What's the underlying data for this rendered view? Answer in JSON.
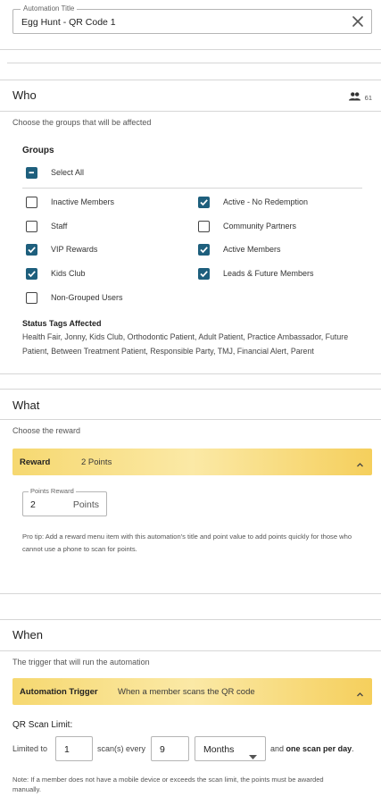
{
  "title_field": {
    "legend": "Automation Title",
    "value": "Egg Hunt - QR Code 1"
  },
  "who": {
    "title": "Who",
    "member_count": "61",
    "subtitle": "Choose the groups that will be affected",
    "groups_label": "Groups",
    "select_all": "Select All",
    "groups": [
      {
        "label": "Inactive Members",
        "checked": false
      },
      {
        "label": "Active - No Redemption",
        "checked": true
      },
      {
        "label": "Staff",
        "checked": false
      },
      {
        "label": "Community Partners",
        "checked": false
      },
      {
        "label": "VIP Rewards",
        "checked": true
      },
      {
        "label": "Active Members",
        "checked": true
      },
      {
        "label": "Kids Club",
        "checked": true
      },
      {
        "label": "Leads & Future Members",
        "checked": true
      },
      {
        "label": "Non-Grouped Users",
        "checked": false
      }
    ],
    "status_tags_label": "Status Tags Affected",
    "status_tags": "Health Fair, Jonny, Kids Club, Orthodontic Patient, Adult Patient, Practice Ambassador, Future Patient, Between Treatment Patient, Responsible Party, TMJ, Financial Alert, Parent"
  },
  "what": {
    "title": "What",
    "subtitle": "Choose the reward",
    "reward_label": "Reward",
    "reward_value": "2 Points",
    "points_legend": "Points Reward",
    "points_value": "2",
    "points_unit": "Points",
    "protip": "Pro tip: Add a reward menu item with this automation's title and point value to add points quickly for those who cannot use a phone to scan for points."
  },
  "when": {
    "title": "When",
    "subtitle": "The trigger that will run the automation",
    "trigger_label": "Automation Trigger",
    "trigger_value": "When a member scans the QR code",
    "qr_limit_label": "QR Scan Limit:",
    "limited_to": "Limited to",
    "scan_count": "1",
    "scans_every": "scan(s) every",
    "period_count": "9",
    "period_unit": "Months",
    "and_text": "and",
    "one_scan": "one scan per day",
    "period_end": ".",
    "note": "Note: If a member does not have a mobile device or exceeds the scan limit, the points must be awarded manually."
  },
  "colors": {
    "accent": "#1e5f7d",
    "trigger_bar": "#f6d870"
  },
  "icons": {
    "clear": "close-icon",
    "members": "people-icon",
    "collapse": "chevron-up-icon",
    "select": "caret-down-icon"
  }
}
